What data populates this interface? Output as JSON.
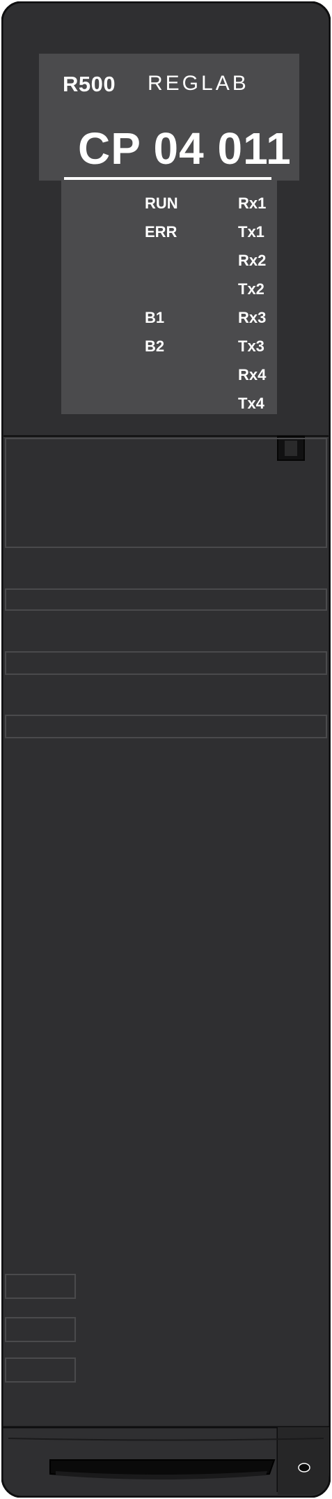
{
  "device": {
    "model": "R500",
    "brand": "REGLAB",
    "part_number": "CP 04 011",
    "left_leds": [
      "RUN",
      "ERR",
      "B1",
      "B2"
    ],
    "right_leds": [
      "Rx1",
      "Tx1",
      "Rx2",
      "Tx2",
      "Rx3",
      "Tx3",
      "Rx4",
      "Tx4"
    ]
  }
}
